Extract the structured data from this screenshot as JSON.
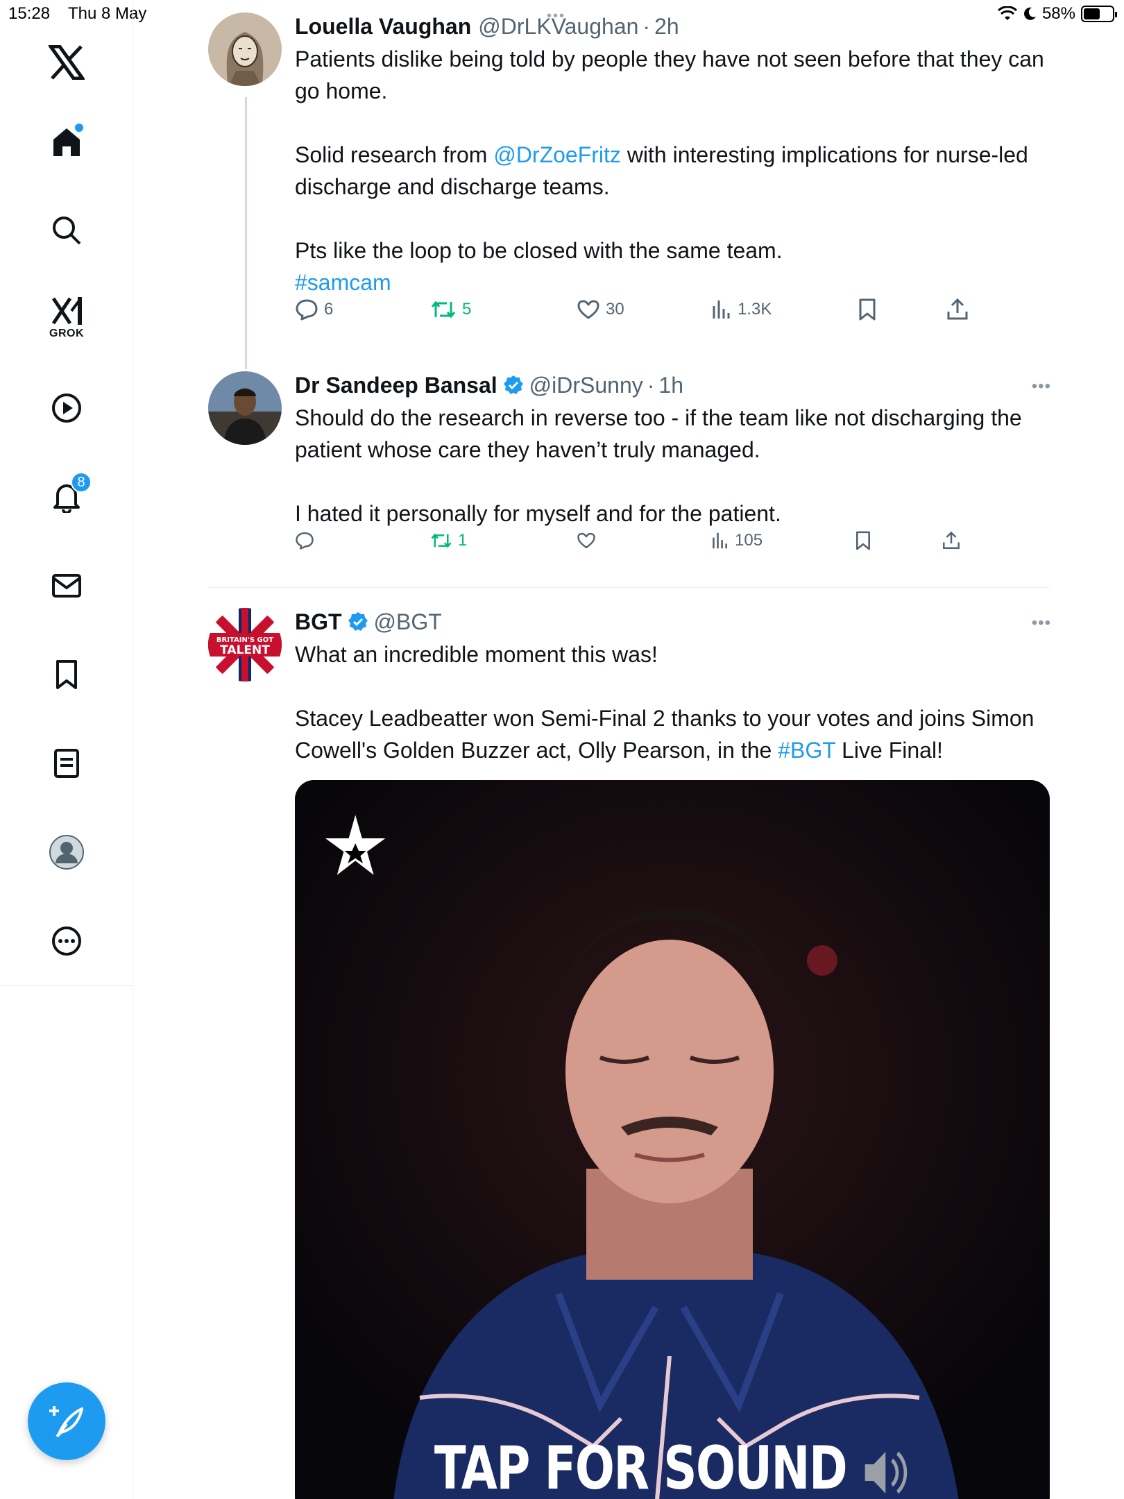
{
  "status_bar": {
    "time": "15:28",
    "date": "Thu 8 May",
    "battery": "58%",
    "battery_level": 0.58
  },
  "sidebar": {
    "notifications_badge": "8",
    "grok_label": "GROK",
    "items": [
      {
        "name": "x-logo",
        "icon": "x-logo-icon"
      },
      {
        "name": "home",
        "icon": "home-icon"
      },
      {
        "name": "explore",
        "icon": "search-icon"
      },
      {
        "name": "grok",
        "icon": "grok-icon"
      },
      {
        "name": "videos",
        "icon": "play-icon"
      },
      {
        "name": "notifications",
        "icon": "bell-icon"
      },
      {
        "name": "messages",
        "icon": "mail-icon"
      },
      {
        "name": "bookmarks",
        "icon": "bookmark-icon"
      },
      {
        "name": "lists",
        "icon": "list-icon"
      },
      {
        "name": "profile",
        "icon": "profile-icon"
      },
      {
        "name": "more",
        "icon": "more-icon"
      }
    ]
  },
  "colors": {
    "accent": "#1d9bf0",
    "retweet": "#00ba7c",
    "secondary_text": "#536471"
  },
  "tweets": [
    {
      "author": "Louella Vaughan",
      "handle": "@DrLKVaughan",
      "time": "2h",
      "lines": {
        "l1": "Patients dislike being told by people they have not seen before that they can go home.",
        "l2a": "Solid research from ",
        "mention": "@DrZoeFritz",
        "l2b": " with interesting implications for nurse-led discharge and discharge teams.",
        "l3": "Pts like the loop to be closed with the same team.",
        "hashtag": "#samcam"
      },
      "replies": "6",
      "retweets": "5",
      "likes": "30",
      "views": "1.3K"
    },
    {
      "author": "Dr Sandeep Bansal",
      "handle": "@iDrSunny",
      "time": "1h",
      "lines": {
        "l1": "Should do the research in reverse too - if the team like not discharging the patient whose care they haven’t truly managed.",
        "l2": "I hated it personally for myself and for the patient."
      },
      "retweets": "1",
      "views": "105"
    },
    {
      "author": "BGT",
      "handle": "@BGT",
      "lines": {
        "l1": "What an incredible moment this was!",
        "l2a": "Stacey Leadbeatter won Semi-Final 2 thanks to your votes and joins Simon Cowell's Golden Buzzer act, Olly Pearson, in the ",
        "hashtag": "#BGT",
        "l2b": " Live Final!"
      },
      "media_caption": "TAP FOR SOUND"
    }
  ]
}
